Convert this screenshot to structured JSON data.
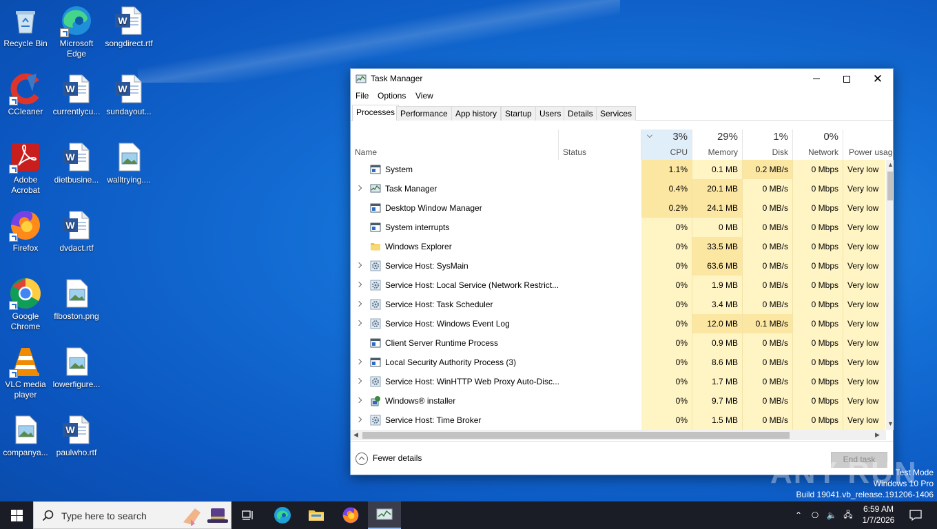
{
  "desktop": {
    "icons": [
      {
        "label": "Recycle Bin",
        "icon": "recycle-bin-icon"
      },
      {
        "label": "Microsoft Edge",
        "icon": "edge-icon"
      },
      {
        "label": "songdirect.rtf",
        "icon": "word-doc-icon"
      },
      {
        "label": "CCleaner",
        "icon": "ccleaner-icon"
      },
      {
        "label": "currentlycu...",
        "icon": "word-doc-icon"
      },
      {
        "label": "sundayout...",
        "icon": "word-doc-icon"
      },
      {
        "label": "Adobe Acrobat",
        "icon": "acrobat-icon"
      },
      {
        "label": "dietbusine...",
        "icon": "word-doc-icon"
      },
      {
        "label": "walltrying....",
        "icon": "image-file-icon"
      },
      {
        "label": "Firefox",
        "icon": "firefox-icon"
      },
      {
        "label": "dvdact.rtf",
        "icon": "word-doc-icon"
      },
      {
        "label": "Google Chrome",
        "icon": "chrome-icon"
      },
      {
        "label": "flboston.png",
        "icon": "image-file-icon"
      },
      {
        "label": "VLC media player",
        "icon": "vlc-icon"
      },
      {
        "label": "lowerfigure...",
        "icon": "image-file-icon"
      },
      {
        "label": "companya...",
        "icon": "image-file-icon"
      },
      {
        "label": "paulwho.rtf",
        "icon": "word-doc-icon"
      }
    ]
  },
  "window": {
    "title": "Task Manager",
    "menu": [
      "File",
      "Options",
      "View"
    ],
    "tabs": [
      "Processes",
      "Performance",
      "App history",
      "Startup",
      "Users",
      "Details",
      "Services"
    ],
    "columns": {
      "name": "Name",
      "status": "Status",
      "cpu": {
        "pct": "3%",
        "label": "CPU"
      },
      "memory": {
        "pct": "29%",
        "label": "Memory"
      },
      "disk": {
        "pct": "1%",
        "label": "Disk"
      },
      "network": {
        "pct": "0%",
        "label": "Network"
      },
      "power": "Power usage"
    },
    "processes": [
      {
        "name": "System",
        "expandable": false,
        "cpu": "1.1%",
        "memory": "0.1 MB",
        "disk": "0.2 MB/s",
        "network": "0 Mbps",
        "power": "Very low",
        "icon": "window-app-icon"
      },
      {
        "name": "Task Manager",
        "expandable": true,
        "cpu": "0.4%",
        "memory": "20.1 MB",
        "disk": "0 MB/s",
        "network": "0 Mbps",
        "power": "Very low",
        "icon": "task-manager-icon"
      },
      {
        "name": "Desktop Window Manager",
        "expandable": false,
        "cpu": "0.2%",
        "memory": "24.1 MB",
        "disk": "0 MB/s",
        "network": "0 Mbps",
        "power": "Very low",
        "icon": "window-app-icon"
      },
      {
        "name": "System interrupts",
        "expandable": false,
        "cpu": "0%",
        "memory": "0 MB",
        "disk": "0 MB/s",
        "network": "0 Mbps",
        "power": "Very low",
        "icon": "window-app-icon"
      },
      {
        "name": "Windows Explorer",
        "expandable": false,
        "cpu": "0%",
        "memory": "33.5 MB",
        "disk": "0 MB/s",
        "network": "0 Mbps",
        "power": "Very low",
        "icon": "folder-icon"
      },
      {
        "name": "Service Host: SysMain",
        "expandable": true,
        "cpu": "0%",
        "memory": "63.6 MB",
        "disk": "0 MB/s",
        "network": "0 Mbps",
        "power": "Very low",
        "icon": "gear-icon"
      },
      {
        "name": "Service Host: Local Service (Network Restrict...",
        "expandable": true,
        "cpu": "0%",
        "memory": "1.9 MB",
        "disk": "0 MB/s",
        "network": "0 Mbps",
        "power": "Very low",
        "icon": "gear-icon"
      },
      {
        "name": "Service Host: Task Scheduler",
        "expandable": true,
        "cpu": "0%",
        "memory": "3.4 MB",
        "disk": "0 MB/s",
        "network": "0 Mbps",
        "power": "Very low",
        "icon": "gear-icon"
      },
      {
        "name": "Service Host: Windows Event Log",
        "expandable": true,
        "cpu": "0%",
        "memory": "12.0 MB",
        "disk": "0.1 MB/s",
        "network": "0 Mbps",
        "power": "Very low",
        "icon": "gear-icon"
      },
      {
        "name": "Client Server Runtime Process",
        "expandable": false,
        "cpu": "0%",
        "memory": "0.9 MB",
        "disk": "0 MB/s",
        "network": "0 Mbps",
        "power": "Very low",
        "icon": "window-app-icon"
      },
      {
        "name": "Local Security Authority Process (3)",
        "expandable": true,
        "cpu": "0%",
        "memory": "8.6 MB",
        "disk": "0 MB/s",
        "network": "0 Mbps",
        "power": "Very low",
        "icon": "window-app-icon"
      },
      {
        "name": "Service Host: WinHTTP Web Proxy Auto-Disc...",
        "expandable": true,
        "cpu": "0%",
        "memory": "1.7 MB",
        "disk": "0 MB/s",
        "network": "0 Mbps",
        "power": "Very low",
        "icon": "gear-icon"
      },
      {
        "name": "Windows® installer",
        "expandable": true,
        "cpu": "0%",
        "memory": "9.7 MB",
        "disk": "0 MB/s",
        "network": "0 Mbps",
        "power": "Very low",
        "icon": "installer-icon"
      },
      {
        "name": "Service Host: Time Broker",
        "expandable": true,
        "cpu": "0%",
        "memory": "1.5 MB",
        "disk": "0 MB/s",
        "network": "0 Mbps",
        "power": "Very low",
        "icon": "gear-icon"
      }
    ],
    "footer": {
      "fewer_details": "Fewer details",
      "end_task": "End task"
    }
  },
  "watermark": {
    "line1": "Test Mode",
    "line2": "Windows 10 Pro",
    "line3": "Build 19041.vb_release.191206-1406",
    "brand": "ANY RUN"
  },
  "taskbar": {
    "search_placeholder": "Type here to search",
    "time": "6:59 AM",
    "date": "1/7/2026"
  },
  "colors": {
    "heat_strong": "#fbe6a2",
    "heat_light": "#fff4c4",
    "accent": "#0078d7"
  }
}
